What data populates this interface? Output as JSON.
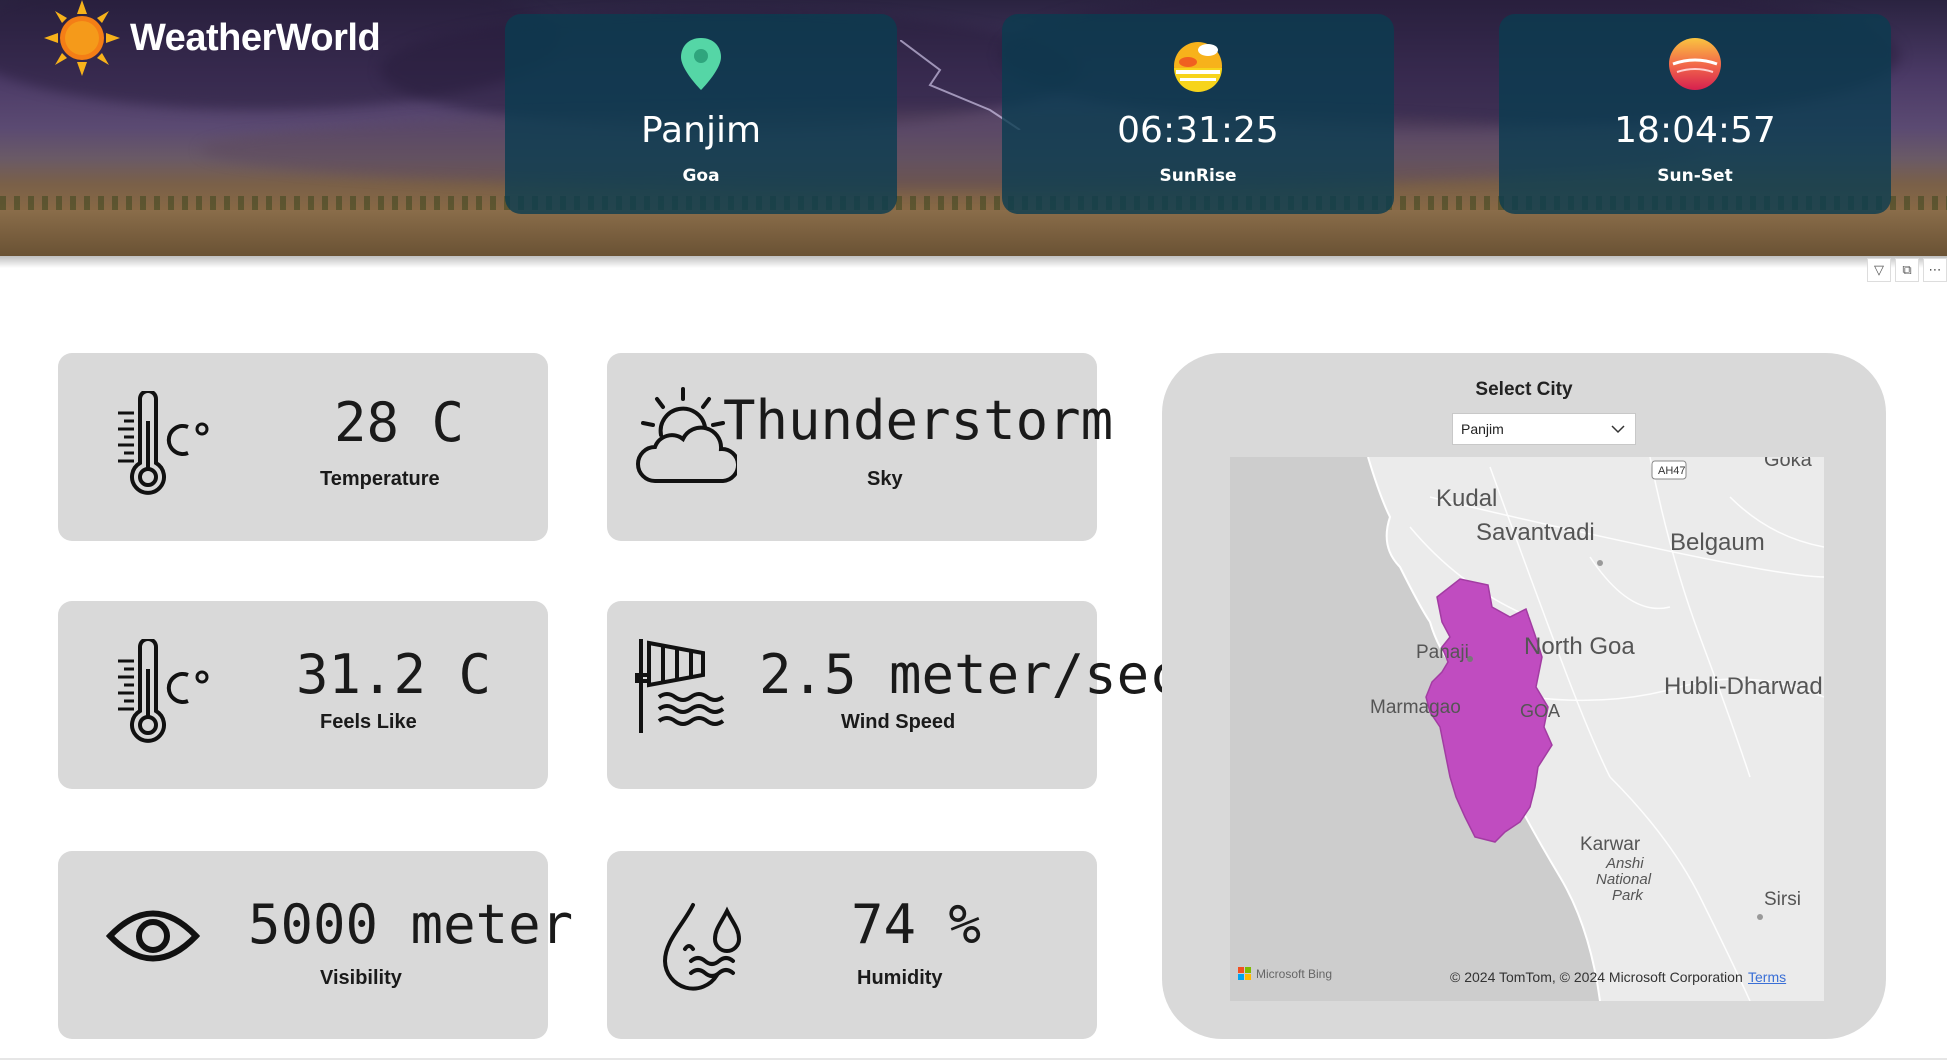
{
  "app": {
    "title": "WeatherWorld"
  },
  "header_cards": [
    {
      "value": "Panjim",
      "label": "Goa",
      "icon": "map-pin-icon"
    },
    {
      "value": "06:31:25",
      "label": "SunRise",
      "icon": "sunrise-icon"
    },
    {
      "value": "18:04:57",
      "label": "Sun-Set",
      "icon": "sunset-icon"
    }
  ],
  "cards": {
    "temperature": {
      "value": "28 C",
      "label": "Temperature",
      "icon": "thermometer-icon"
    },
    "sky": {
      "value": "Thunderstorm",
      "label": "Sky",
      "icon": "sun-cloud-icon"
    },
    "feels_like": {
      "value": "31.2 C",
      "label": "Feels Like",
      "icon": "thermometer-icon"
    },
    "wind_speed": {
      "value": "2.5 meter/sec",
      "label": "Wind Speed",
      "icon": "windsock-icon"
    },
    "visibility": {
      "value": "5000 meter",
      "label": "Visibility",
      "icon": "eye-icon"
    },
    "humidity": {
      "value": "74 %",
      "label": "Humidity",
      "icon": "droplets-icon"
    }
  },
  "city_selector": {
    "title": "Select City",
    "selected": "Panjim"
  },
  "map": {
    "labels": {
      "kudal": "Kudal",
      "savantvadi": "Savantvadi",
      "belgaum": "Belgaum",
      "panaji": "Panaji",
      "north_goa": "North Goa",
      "hubli": "Hubli-Dharwad",
      "marmagao": "Marmagao",
      "goa": "GOA",
      "karwar": "Karwar",
      "anshi": "Anshi",
      "national": "National",
      "park": "Park",
      "sirsi": "Sirsi",
      "highway": "AH47",
      "gokak": "Goka"
    },
    "attribution": "© 2024 TomTom, © 2024 Microsoft Corporation",
    "terms": "Terms",
    "provider": "Microsoft Bing"
  },
  "colors": {
    "header_card": "#0a3c50",
    "card_bg": "#d9d9d9",
    "region": "#c04cc0",
    "accent_sun": "#f7a31b"
  }
}
